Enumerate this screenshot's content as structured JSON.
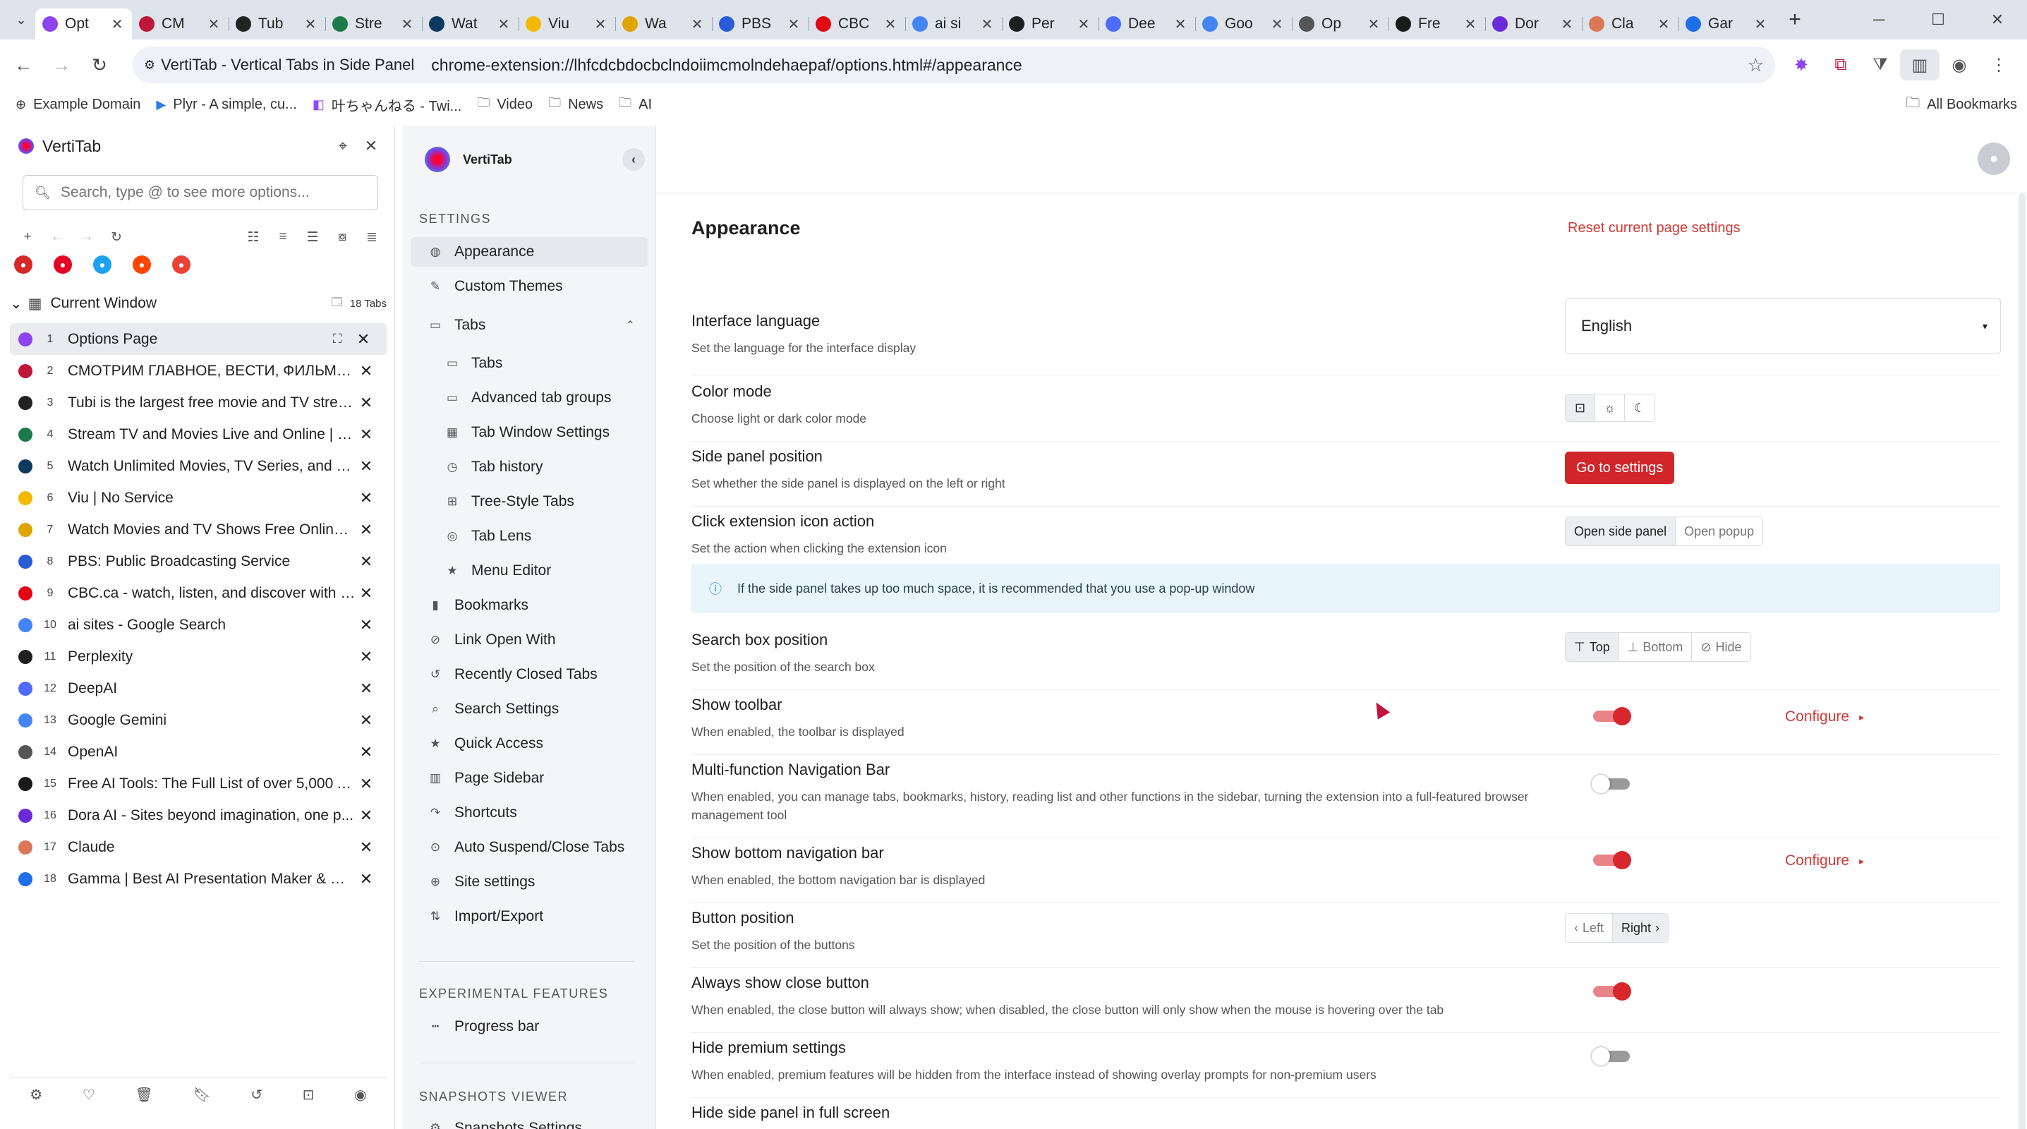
{
  "browser": {
    "tabs": [
      {
        "title": "Opt",
        "color": "#8e44ec",
        "active": true
      },
      {
        "title": "CM",
        "color": "#c0163a"
      },
      {
        "title": "Tub",
        "color": "#222222"
      },
      {
        "title": "Stre",
        "color": "#1a7a4a"
      },
      {
        "title": "Wat",
        "color": "#0d3a5c"
      },
      {
        "title": "Viu",
        "color": "#f5b800"
      },
      {
        "title": "Wa",
        "color": "#e0a400"
      },
      {
        "title": "PBS",
        "color": "#2a5bd7"
      },
      {
        "title": "CBC",
        "color": "#e30613"
      },
      {
        "title": "ai si",
        "color": "#4285f4"
      },
      {
        "title": "Per",
        "color": "#1f1f1f"
      },
      {
        "title": "Dee",
        "color": "#4d6bfe"
      },
      {
        "title": "Goo",
        "color": "#4285f4"
      },
      {
        "title": "Op",
        "color": "#555555"
      },
      {
        "title": "Fre",
        "color": "#1a1a1a"
      },
      {
        "title": "Dor",
        "color": "#6c2bd9"
      },
      {
        "title": "Cla",
        "color": "#d97757"
      },
      {
        "title": "Gar",
        "color": "#1f6feb"
      }
    ],
    "window_controls": {
      "minimize": "─",
      "maximize": "☐",
      "close": "✕"
    },
    "new_tab": "+",
    "omnibox": {
      "chip_label": "VertiTab - Vertical Tabs in Side Panel",
      "url": "chrome-extension://lhfcdcbdocbclndoiimcmolndehaepaf/options.html#/appearance"
    },
    "bookmarks": [
      {
        "label": "Example Domain",
        "icon": "globe-icon"
      },
      {
        "label": "Plyr - A simple, cu...",
        "icon": "play-icon"
      },
      {
        "label": "叶ちゃんねる - Twi...",
        "icon": "twitch-icon"
      },
      {
        "label": "Video",
        "icon": "folder-icon"
      },
      {
        "label": "News",
        "icon": "folder-icon"
      },
      {
        "label": "AI",
        "icon": "folder-icon"
      }
    ],
    "all_bookmarks": "All Bookmarks"
  },
  "sidepanel": {
    "title": "VertiTab",
    "search_placeholder": "Search, type @ to see more options...",
    "window_label": "Current Window",
    "tab_count": "18 Tabs",
    "pinned_colors": [
      "#d62828",
      "#e60023",
      "#1da1f2",
      "#ff4500",
      "#ea4335"
    ],
    "tabs": [
      {
        "num": "1",
        "title": "Options Page",
        "color": "#8e44ec",
        "active": true
      },
      {
        "num": "2",
        "title": "СМОТРИМ ГЛАВНОЕ, ВЕСТИ, ФИЛЬМЫ, ...",
        "color": "#c0163a"
      },
      {
        "num": "3",
        "title": "Tubi is the largest free movie and TV strea...",
        "color": "#222222"
      },
      {
        "num": "4",
        "title": "Stream TV and Movies Live and Online | H...",
        "color": "#1a7a4a"
      },
      {
        "num": "5",
        "title": "Watch Unlimited Movies, TV Series, and Or...",
        "color": "#0d3a5c"
      },
      {
        "num": "6",
        "title": "Viu | No Service",
        "color": "#f5b800"
      },
      {
        "num": "7",
        "title": "Watch Movies and TV Shows Free Online -...",
        "color": "#e0a400"
      },
      {
        "num": "8",
        "title": "PBS: Public Broadcasting Service",
        "color": "#2a5bd7"
      },
      {
        "num": "9",
        "title": "CBC.ca - watch, listen, and discover with C...",
        "color": "#e30613"
      },
      {
        "num": "10",
        "title": "ai sites - Google Search",
        "color": "#4285f4"
      },
      {
        "num": "11",
        "title": "Perplexity",
        "color": "#1f1f1f"
      },
      {
        "num": "12",
        "title": "DeepAI",
        "color": "#4d6bfe"
      },
      {
        "num": "13",
        "title": "Google Gemini",
        "color": "#4285f4"
      },
      {
        "num": "14",
        "title": "OpenAI",
        "color": "#555555"
      },
      {
        "num": "15",
        "title": "Free AI Tools: The Full List of over 5,000 AI ...",
        "color": "#1a1a1a"
      },
      {
        "num": "16",
        "title": "Dora AI - Sites beyond imagination, one p...",
        "color": "#6c2bd9"
      },
      {
        "num": "17",
        "title": "Claude",
        "color": "#d97757"
      },
      {
        "num": "18",
        "title": "Gamma | Best AI Presentation Maker & W...",
        "color": "#1f6feb"
      }
    ]
  },
  "options": {
    "brand": "VertiTab",
    "sections": {
      "settings": "SETTINGS",
      "experimental": "EXPERIMENTAL FEATURES",
      "snapshots": "SNAPSHOTS VIEWER"
    },
    "nav": {
      "appearance": "Appearance",
      "custom_themes": "Custom Themes",
      "tabs_group": "Tabs",
      "tabs": "Tabs",
      "advanced_tab_groups": "Advanced tab groups",
      "tab_window_settings": "Tab Window Settings",
      "tab_history": "Tab history",
      "tree_style_tabs": "Tree-Style Tabs",
      "tab_lens": "Tab Lens",
      "menu_editor": "Menu Editor",
      "bookmarks": "Bookmarks",
      "link_open_with": "Link Open With",
      "recently_closed_tabs": "Recently Closed Tabs",
      "search_settings": "Search Settings",
      "quick_access": "Quick Access",
      "page_sidebar": "Page Sidebar",
      "shortcuts": "Shortcuts",
      "auto_suspend": "Auto Suspend/Close Tabs",
      "site_settings": "Site settings",
      "import_export": "Import/Export",
      "progress_bar": "Progress bar",
      "snapshots_settings": "Snapshots Settings"
    }
  },
  "content": {
    "title": "Appearance",
    "reset": "Reset current page settings",
    "interface_language": {
      "label": "Interface language",
      "desc": "Set the language for the interface display",
      "value": "English"
    },
    "color_mode": {
      "label": "Color mode",
      "desc": "Choose light or dark color mode"
    },
    "side_panel_position": {
      "label": "Side panel position",
      "desc": "Set whether the side panel is displayed on the left or right",
      "button": "Go to settings"
    },
    "click_action": {
      "label": "Click extension icon action",
      "desc": "Set the action when clicking the extension icon",
      "options": [
        "Open side panel",
        "Open popup"
      ],
      "selected": "Open side panel"
    },
    "info": "If the side panel takes up too much space, it is recommended that you use a pop-up window",
    "search_box_position": {
      "label": "Search box position",
      "desc": "Set the position of the search box",
      "options": [
        "Top",
        "Bottom",
        "Hide"
      ],
      "selected": "Top"
    },
    "show_toolbar": {
      "label": "Show toolbar",
      "desc": "When enabled, the toolbar is displayed",
      "enabled": true,
      "configure": "Configure"
    },
    "multi_nav": {
      "label": "Multi-function Navigation Bar",
      "desc": "When enabled, you can manage tabs, bookmarks, history, reading list and other functions in the sidebar, turning the extension into a full-featured browser management tool",
      "enabled": false
    },
    "bottom_nav": {
      "label": "Show bottom navigation bar",
      "desc": "When enabled, the bottom navigation bar is displayed",
      "enabled": true,
      "configure": "Configure"
    },
    "button_position": {
      "label": "Button position",
      "desc": "Set the position of the buttons",
      "options": [
        "Left",
        "Right"
      ],
      "selected": "Right"
    },
    "always_close": {
      "label": "Always show close button",
      "desc": "When enabled, the close button will always show; when disabled, the close button will only show when the mouse is hovering over the tab",
      "enabled": true
    },
    "hide_premium": {
      "label": "Hide premium settings",
      "desc": "When enabled, premium features will be hidden from the interface instead of showing overlay prompts for non-premium users",
      "enabled": false
    },
    "hide_fullscreen": {
      "label": "Hide side panel in full screen"
    }
  }
}
